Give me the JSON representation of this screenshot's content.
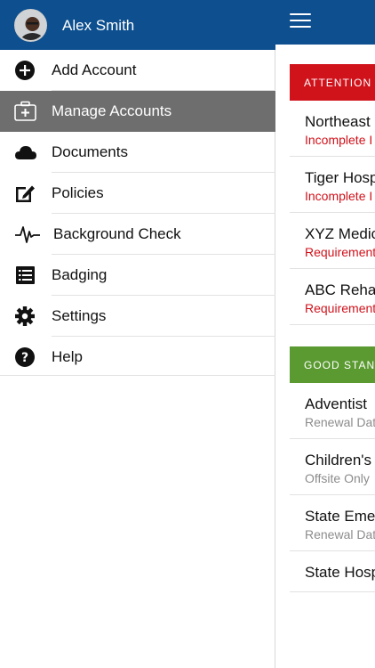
{
  "drawer": {
    "user_name": "Alex Smith",
    "items": [
      {
        "label": "Add Account",
        "icon": "plus-circle-icon"
      },
      {
        "label": "Manage Accounts",
        "icon": "medical-briefcase-icon",
        "active": true
      },
      {
        "label": "Documents",
        "icon": "cloud-icon"
      },
      {
        "label": "Policies",
        "icon": "edit-icon"
      },
      {
        "label": "Background Check",
        "icon": "pulse-icon"
      },
      {
        "label": "Badging",
        "icon": "list-icon"
      },
      {
        "label": "Settings",
        "icon": "gear-icon"
      },
      {
        "label": "Help",
        "icon": "question-icon"
      }
    ]
  },
  "main": {
    "attention_label": "ATTENTION",
    "good_label": "GOOD STAN",
    "attention_rows": [
      {
        "title": "Northeast",
        "subtitle": "Incomplete I"
      },
      {
        "title": "Tiger Hosp",
        "subtitle": "Incomplete I"
      },
      {
        "title": "XYZ Medic",
        "subtitle": "Requirement"
      },
      {
        "title": "ABC Reha",
        "subtitle": "Requirement"
      }
    ],
    "good_rows": [
      {
        "title": "Adventist",
        "subtitle": "Renewal Dat"
      },
      {
        "title": "Children's",
        "subtitle": "Offsite Only"
      },
      {
        "title": "State Eme",
        "subtitle": "Renewal Dat"
      },
      {
        "title": "State Hosp",
        "subtitle": ""
      }
    ]
  },
  "colors": {
    "header_blue": "#0d4f8f",
    "attention_red": "#d0121b",
    "good_green": "#5a9a31",
    "active_gray": "#6e6e6e"
  }
}
